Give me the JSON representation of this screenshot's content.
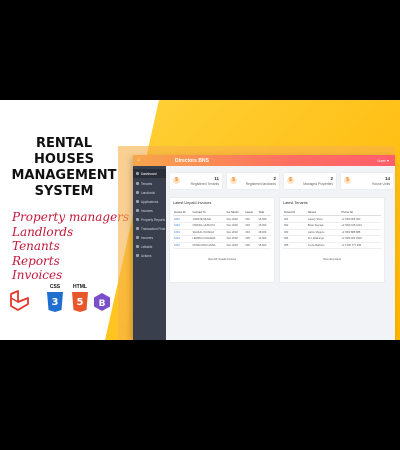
{
  "promo": {
    "title_lines": [
      "RENTAL HOUSES",
      "MANAGEMENT",
      "SYSTEM"
    ],
    "features": [
      "Property managers",
      "Landlords",
      "Tenants",
      "Reports",
      "Invoices"
    ],
    "tech_badges": [
      "CSS",
      "HTML"
    ],
    "colors": {
      "title": "#111111",
      "features": "#c2183a",
      "accent": "#ffb400"
    }
  },
  "app": {
    "brand": "⌂",
    "title": "Directors BNS",
    "user": "User ▾",
    "sidebar": [
      {
        "label": "Dashboard",
        "active": true
      },
      {
        "label": "Tenants"
      },
      {
        "label": "Landlords"
      },
      {
        "label": "Applications"
      },
      {
        "label": "Invoices"
      },
      {
        "label": "Property Reports"
      },
      {
        "label": "Transaction Flow"
      },
      {
        "label": "Incomes"
      },
      {
        "label": "Lettable"
      },
      {
        "label": "Actions"
      }
    ],
    "stats": [
      {
        "value": "11",
        "label": "Registered Tenants",
        "icon": "$"
      },
      {
        "value": "2",
        "label": "Registered landlords",
        "icon": "$"
      },
      {
        "value": "2",
        "label": "Managed Properties",
        "icon": "$"
      },
      {
        "value": "14",
        "label": "House Units",
        "icon": "$"
      }
    ],
    "invoices": {
      "title": "Latest Unpaid Invoices",
      "columns": [
        "Invoice ID",
        "Contract To",
        "For Month",
        "House",
        "Total"
      ],
      "rows": [
        [
          "1001",
          "JUMATE MUGE",
          "Dec 2018",
          "002",
          "15,000"
        ],
        [
          "1001",
          "OWINGL HURAIYA",
          "Dec 2018",
          "003",
          "15,000"
        ],
        [
          "1001",
          "SHAKALI KUNGIA",
          "Dec 2018",
          "004",
          "18,000"
        ],
        [
          "1001",
          "LEMMA KUNGAMA",
          "Dec 2018",
          "005",
          "12,000"
        ],
        [
          "1001",
          "NOSE NINGI ANNA",
          "Dec 2018",
          "006",
          "15,000"
        ]
      ],
      "footer": "View All Unpaid Invoices"
    },
    "tenants": {
      "title": "Latest Tenants",
      "columns": [
        "Tenant ID",
        "Names",
        "Phone No"
      ],
      "rows": [
        [
          "001",
          "Lanery Shop",
          "+17000 366 000"
        ],
        [
          "002",
          "Brian Semaja",
          "+17000 445 1010"
        ],
        [
          "003",
          "Lahim Muguru",
          "+17000 888 888"
        ],
        [
          "004",
          "Kim Wakungu",
          "+17000 454 2020"
        ],
        [
          "005",
          "Joyce Barbers",
          "+17 000 777 999"
        ]
      ],
      "footer": "View all tenants"
    }
  }
}
